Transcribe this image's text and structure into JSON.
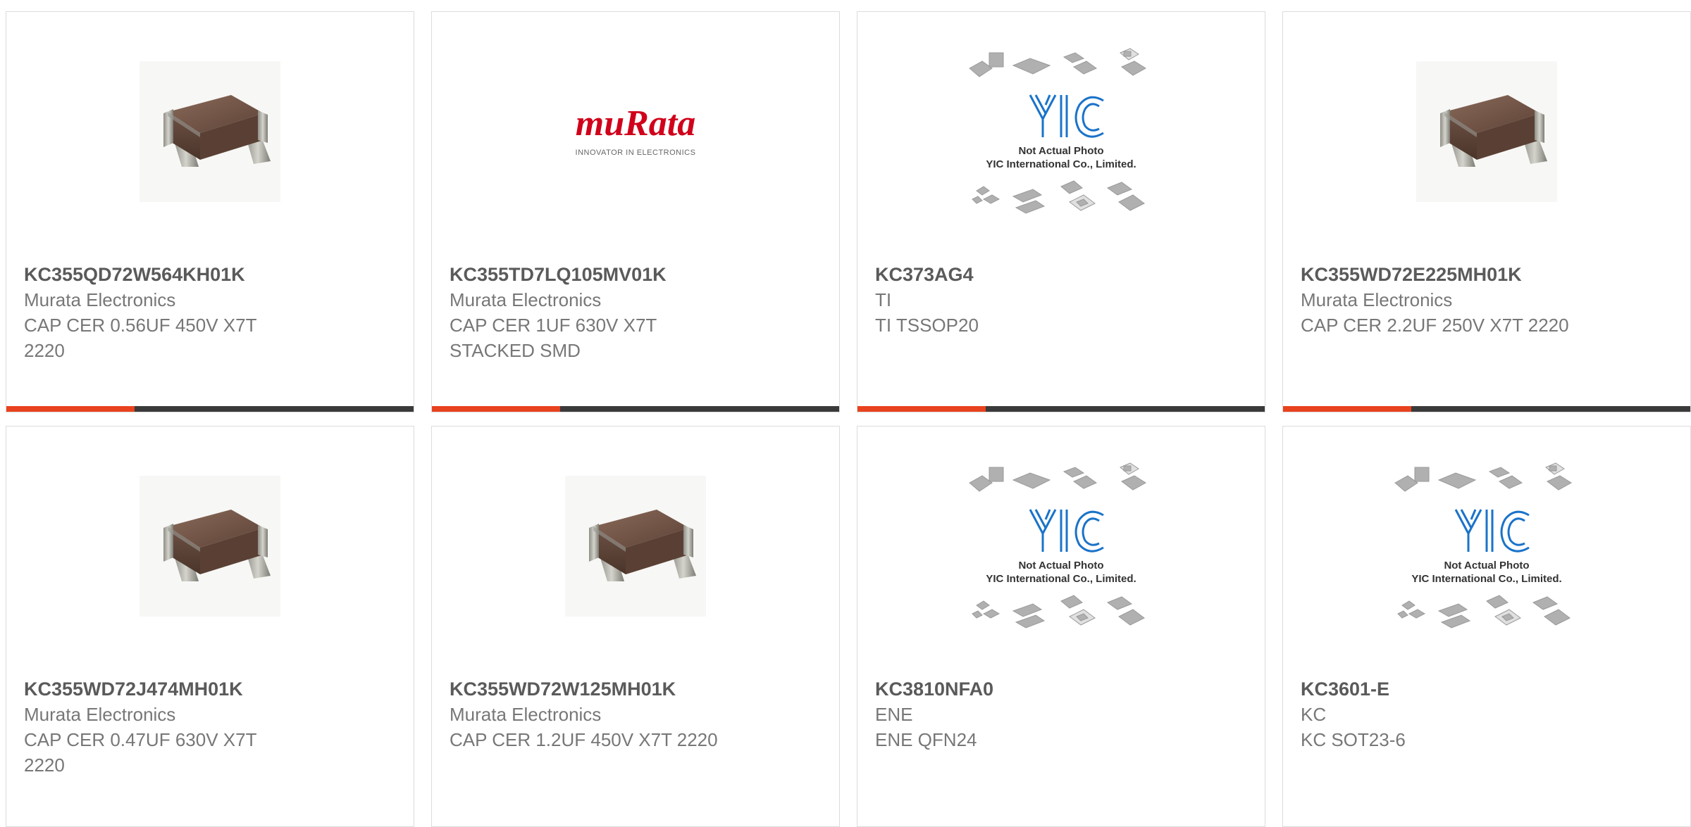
{
  "accent_color": "#e8421e",
  "products": [
    {
      "part_number": "KC355QD72W564KH01K",
      "manufacturer": "Murata Electronics",
      "description": "CAP CER 0.56UF 450V X7T\n2220",
      "image": "capacitor-photo",
      "show_bar": true
    },
    {
      "part_number": "KC355TD7LQ105MV01K",
      "manufacturer": "Murata Electronics",
      "description": "CAP CER 1UF 630V X7T\nSTACKED SMD",
      "image": "murata-logo",
      "logo_text": "muRata",
      "logo_tagline": "INNOVATOR IN ELECTRONICS",
      "show_bar": true
    },
    {
      "part_number": "KC373AG4",
      "manufacturer": "TI",
      "description": "TI TSSOP20",
      "image": "yic-placeholder",
      "placeholder_line1": "Not Actual Photo",
      "placeholder_line2": "YIC International Co., Limited.",
      "show_bar": true
    },
    {
      "part_number": "KC355WD72E225MH01K",
      "manufacturer": "Murata Electronics",
      "description": "CAP CER 2.2UF 250V X7T 2220",
      "image": "capacitor-photo",
      "show_bar": true
    },
    {
      "part_number": "KC355WD72J474MH01K",
      "manufacturer": "Murata Electronics",
      "description": "CAP CER 0.47UF 630V X7T\n2220",
      "image": "capacitor-photo",
      "show_bar": false
    },
    {
      "part_number": "KC355WD72W125MH01K",
      "manufacturer": "Murata Electronics",
      "description": "CAP CER 1.2UF 450V X7T 2220",
      "image": "capacitor-photo",
      "show_bar": false
    },
    {
      "part_number": "KC3810NFA0",
      "manufacturer": "ENE",
      "description": "ENE QFN24",
      "image": "yic-placeholder",
      "placeholder_line1": "Not Actual Photo",
      "placeholder_line2": "YIC International Co., Limited.",
      "show_bar": false
    },
    {
      "part_number": "KC3601-E",
      "manufacturer": "KC",
      "description": "KC SOT23-6",
      "image": "yic-placeholder",
      "placeholder_line1": "Not Actual Photo",
      "placeholder_line2": "YIC International Co., Limited.",
      "show_bar": false
    }
  ]
}
